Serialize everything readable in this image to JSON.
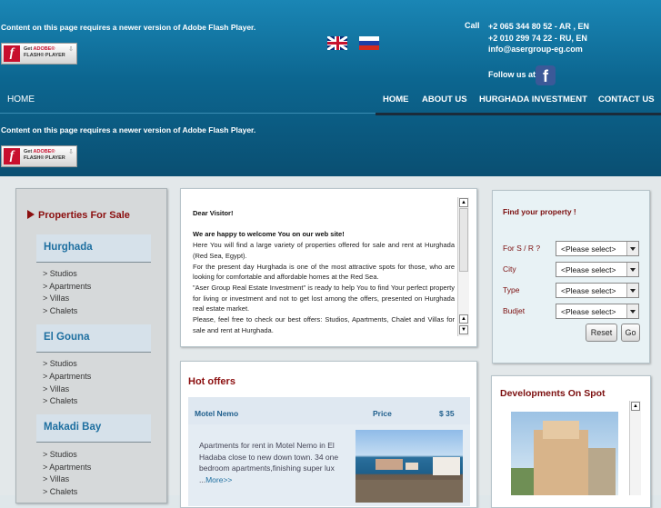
{
  "flash": {
    "message": "Content on this page requires a newer version of Adobe Flash Player.",
    "badge_icon": "f",
    "badge_line1_prefix": "Get ",
    "badge_line1_brand": "ADOBE®",
    "badge_line2": "FLASH® PLAYER",
    "badge_arrow": "⇩"
  },
  "contact": {
    "call_label": "Call",
    "phone1": "+2 065 344 80 52 - AR , EN",
    "phone2": "+2 010 299 74 22 - RU, EN",
    "email": "info@asergroup-eg.com",
    "follow_label": "Follow us at",
    "facebook_icon": "f"
  },
  "nav": {
    "left_home": "HOME",
    "items": [
      "HOME",
      "ABOUT US",
      "HURGHADA INVESTMENT",
      "CONTACT US"
    ]
  },
  "sidebar": {
    "title": "Properties For Sale",
    "categories": [
      {
        "name": "Hurghada",
        "items": [
          "> Studios",
          "> Apartments",
          "> Villas",
          "> Chalets"
        ]
      },
      {
        "name": "El Gouna",
        "items": [
          "> Studios",
          "> Apartments",
          "> Villas",
          "> Chalets"
        ]
      },
      {
        "name": "Makadi Bay",
        "items": [
          "> Studios",
          "> Apartments",
          "> Villas",
          "> Chalets"
        ]
      }
    ]
  },
  "welcome": {
    "greeting": "Dear Visitor!",
    "heading": "We are happy to welcome You on our web site!",
    "p1": "Here You will find a large variety of properties offered for sale and rent at Hurghada (Red Sea, Egypt).",
    "p2": "For the present day Hurghada is one of the most attractive spots for those, who are looking for comfortable and affordable homes at the Red Sea.",
    "p3": "\"Aser Group Real Estate Investment\" is ready to help You to find Your perfect property for living or investment and not to get lost among the offers, presented on Hurghada real estate market.",
    "p4": "Please, feel free to check our best offers: Studios, Apartments, Chalet and Villas for sale and rent at Hurghada."
  },
  "find": {
    "title": "Find your property !",
    "fields": [
      {
        "label": "For S / R ?",
        "value": "<Please select>"
      },
      {
        "label": "City",
        "value": "<Please select>"
      },
      {
        "label": "Type",
        "value": "<Please select>"
      },
      {
        "label": "Budjet",
        "value": "<Please select>"
      }
    ],
    "reset": "Reset",
    "go": "Go"
  },
  "hot": {
    "title": "Hot offers",
    "name": "Motel Nemo",
    "price_label": "Price",
    "price": "$ 35",
    "desc": "Apartments for rent in Motel Nemo in El Hadaba close to new down town. 34 one bedroom apartments,finishing super lux ...",
    "more": "More>>"
  },
  "developments": {
    "title": "Developments On Spot"
  },
  "colors": {
    "header": "#0c6690",
    "accent_red": "#8b0e0e",
    "link_blue": "#1e6fa0"
  }
}
